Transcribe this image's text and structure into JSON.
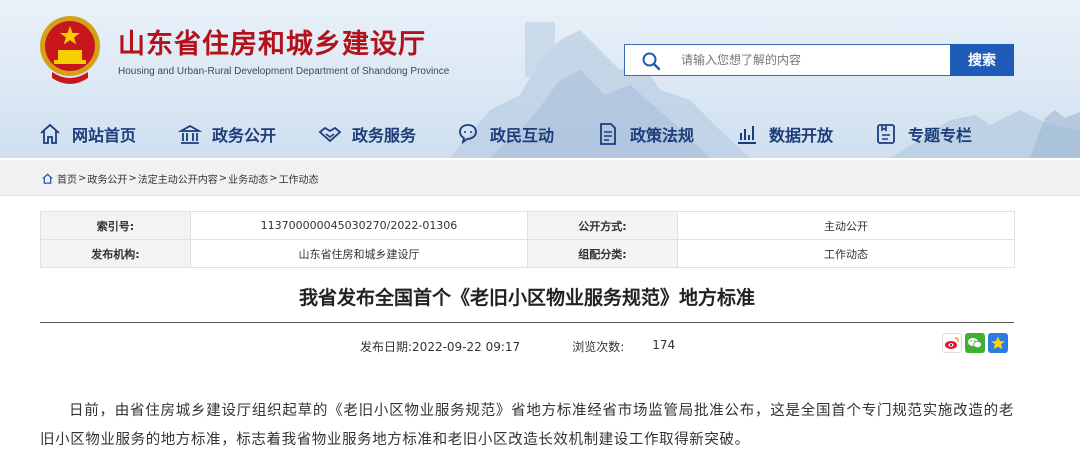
{
  "header": {
    "site_title": "山东省住房和城乡建设厅",
    "site_subtitle": "Housing and Urban-Rural Development Department of Shandong Province",
    "emblem_icon": "national-emblem-icon",
    "search": {
      "placeholder": "请输入您想了解的内容",
      "button_label": "搜索",
      "icon": "search-icon"
    },
    "colors": {
      "title_red": "#b3121b",
      "nav_blue": "#1c3d7a",
      "button_blue": "#1f5bb8"
    }
  },
  "nav": {
    "items": [
      {
        "label": "网站首页",
        "icon": "home-icon"
      },
      {
        "label": "政务公开",
        "icon": "government-building-icon"
      },
      {
        "label": "政务服务",
        "icon": "handshake-icon"
      },
      {
        "label": "政民互动",
        "icon": "chat-icon"
      },
      {
        "label": "政策法规",
        "icon": "document-icon"
      },
      {
        "label": "数据开放",
        "icon": "bar-chart-icon"
      },
      {
        "label": "专题专栏",
        "icon": "topic-icon"
      }
    ]
  },
  "breadcrumb": {
    "items": [
      "首页",
      "政务公开",
      "法定主动公开内容",
      "业务动态",
      "工作动态"
    ],
    "separator": ">"
  },
  "info": {
    "index_label": "索引号:",
    "index_value": "113700000045030270/2022-01306",
    "disclosure_label": "公开方式:",
    "disclosure_value": "主动公开",
    "publisher_label": "发布机构:",
    "publisher_value": "山东省住房和城乡建设厅",
    "category_label": "组配分类:",
    "category_value": "工作动态"
  },
  "article": {
    "title": "我省发布全国首个《老旧小区物业服务规范》地方标准",
    "publish_date": "发布日期:2022-09-22 09:17",
    "views_label": "浏览次数:",
    "views_value": "174",
    "share_icons": [
      "weibo-icon",
      "wechat-icon",
      "favorite-star-icon"
    ],
    "body": "日前，由省住房城乡建设厅组织起草的《老旧小区物业服务规范》省地方标准经省市场监管局批准公布，这是全国首个专门规范实施改造的老旧小区物业服务的地方标准，标志着我省物业服务地方标准和老旧小区改造长效机制建设工作取得新突破。"
  }
}
